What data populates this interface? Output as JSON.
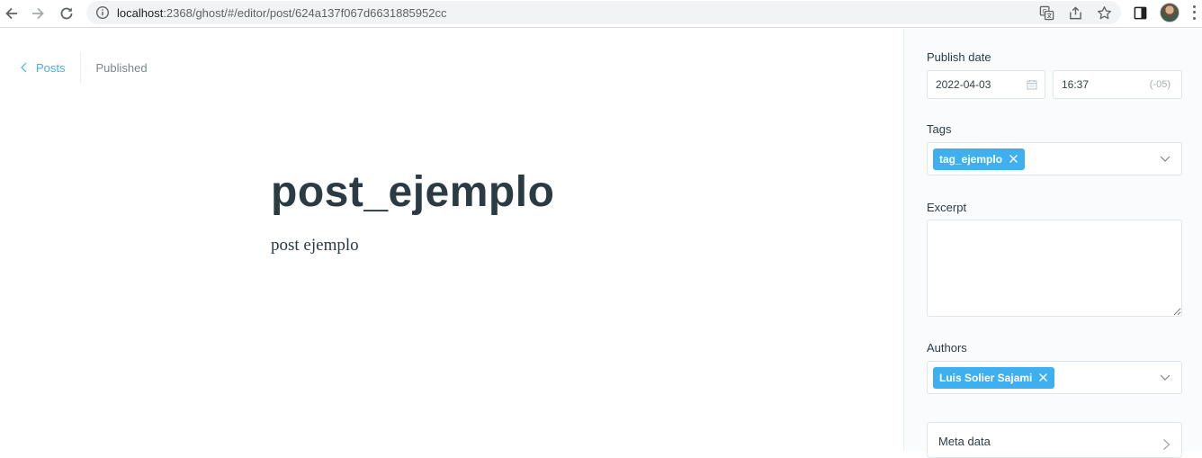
{
  "browser": {
    "url_host": "localhost",
    "url_path": ":2368/ghost/#/editor/post/624a137f067d6631885952cc"
  },
  "editor": {
    "back_label": "Posts",
    "status": "Published",
    "title": "post_ejemplo",
    "body": "post ejemplo"
  },
  "settings": {
    "publish_date_label": "Publish date",
    "date_value": "2022-04-03",
    "time_value": "16:37",
    "timezone": "(-05)",
    "tags_label": "Tags",
    "tags": [
      "tag_ejemplo"
    ],
    "excerpt_label": "Excerpt",
    "excerpt_value": "",
    "authors_label": "Authors",
    "authors": [
      "Luis Solier Sajami"
    ],
    "meta_label": "Meta data"
  },
  "colors": {
    "accent": "#3eb0ef",
    "title_text": "#2b3b44",
    "sidebar_bg": "#f9fbfc"
  },
  "icons": {
    "back": "arrow-left-icon",
    "forward": "arrow-right-icon",
    "reload": "reload-icon",
    "site_info": "info-icon",
    "translate": "translate-icon",
    "share": "share-icon",
    "bookmark": "star-icon",
    "side_panel": "side-panel-icon",
    "menu": "kebab-menu-icon",
    "calendar": "calendar-icon",
    "remove": "close-icon",
    "dropdown": "chevron-down-icon",
    "expand": "chevron-right-icon"
  }
}
